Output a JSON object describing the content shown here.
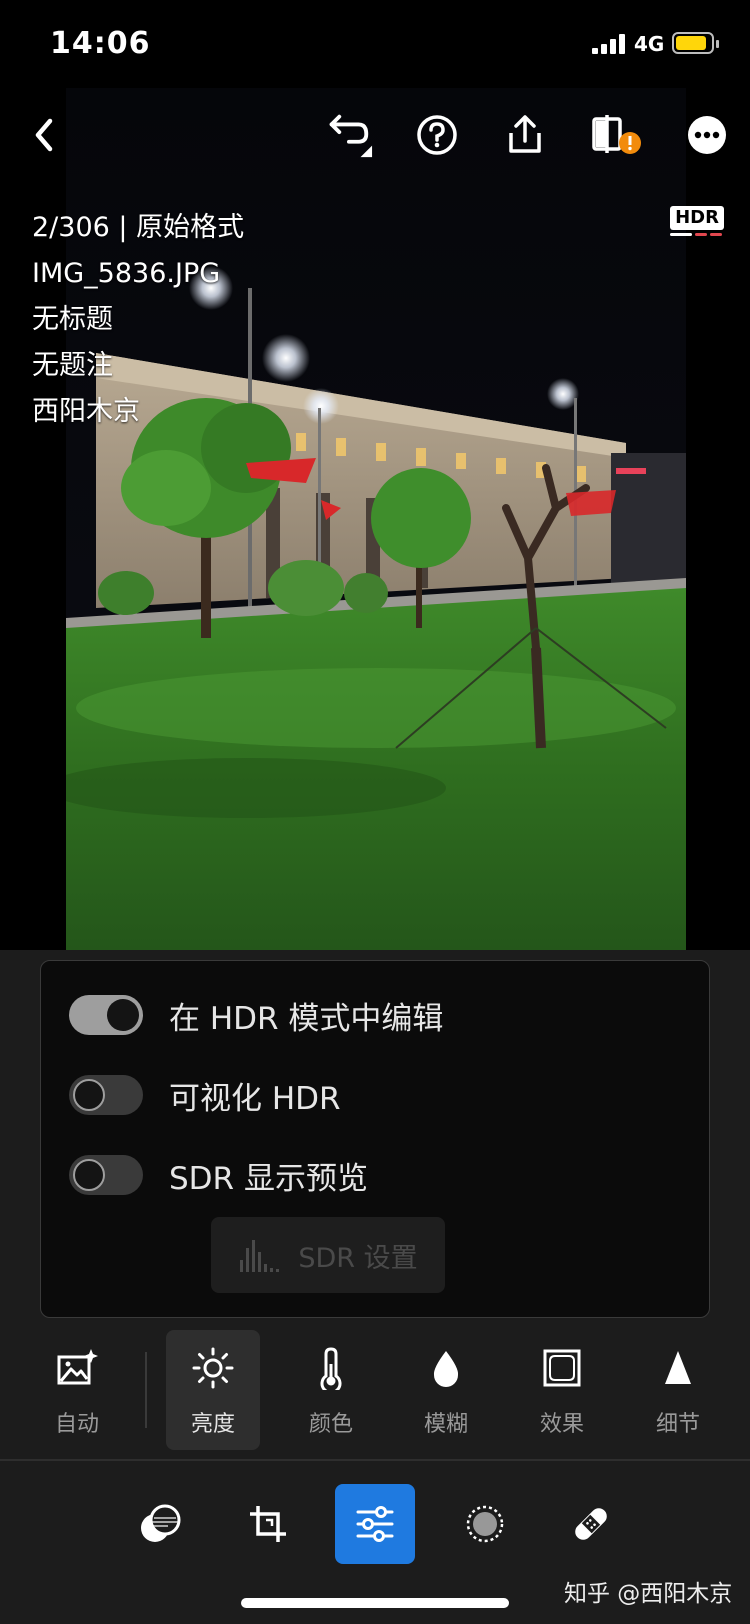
{
  "status_bar": {
    "time": "14:06",
    "network": "4G",
    "battery_level": 0.85,
    "battery_color": "#ffd60a"
  },
  "toolbar": {
    "back_icon": "chevron-left-icon",
    "undo_icon": "undo-icon",
    "help_icon": "help-circle-icon",
    "share_icon": "share-icon",
    "compare_icon": "compare-warning-icon",
    "more_icon": "more-icon"
  },
  "photo_info": {
    "position": "2/306 | 原始格式",
    "filename": "IMG_5836.JPG",
    "title": "无标题",
    "caption": "无题注",
    "author": "西阳木京"
  },
  "hdr_badge": {
    "label": "HDR"
  },
  "hdr_panel": {
    "toggles": [
      {
        "label": "在 HDR 模式中编辑",
        "on": true
      },
      {
        "label": "可视化 HDR",
        "on": false
      },
      {
        "label": "SDR 显示预览",
        "on": false
      }
    ],
    "sdr_settings_label": "SDR 设置"
  },
  "adjust_tabs": [
    {
      "label": "自动",
      "icon": "auto-photo-icon",
      "active": false
    },
    {
      "label": "亮度",
      "icon": "sun-icon",
      "active": true
    },
    {
      "label": "颜色",
      "icon": "thermometer-icon",
      "active": false
    },
    {
      "label": "模糊",
      "icon": "drop-icon",
      "active": false
    },
    {
      "label": "效果",
      "icon": "vignette-icon",
      "active": false
    },
    {
      "label": "细节",
      "icon": "triangle-icon",
      "active": false
    }
  ],
  "tools": [
    {
      "icon": "presets-icon",
      "active": false
    },
    {
      "icon": "crop-icon",
      "active": false
    },
    {
      "icon": "sliders-icon",
      "active": true
    },
    {
      "icon": "masking-icon",
      "active": false
    },
    {
      "icon": "healing-icon",
      "active": false
    }
  ],
  "colors": {
    "accent": "#1f7ae0",
    "panel_bg": "#1c1c1c",
    "card_bg": "#0b0b0b"
  },
  "watermark": "知乎 @西阳木京"
}
